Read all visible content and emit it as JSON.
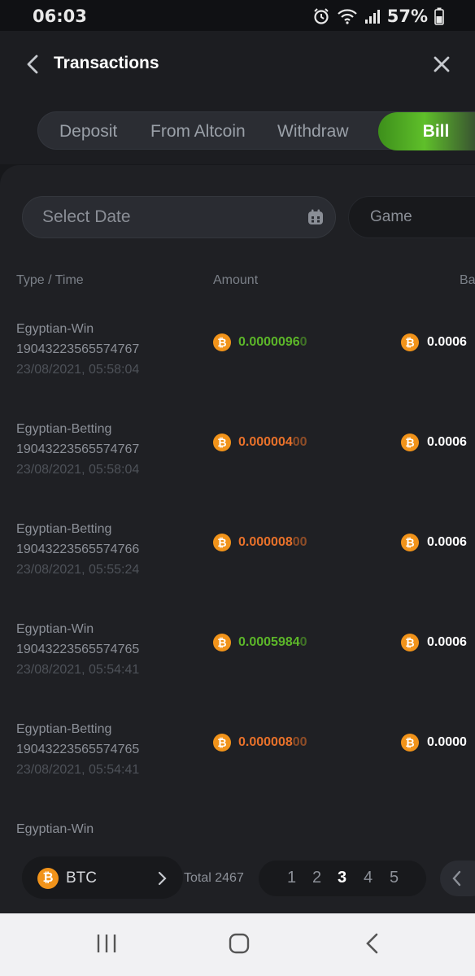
{
  "status_bar": {
    "time": "06:03",
    "battery": "57%",
    "icons": [
      "alarm-icon",
      "wifi-icon",
      "signal-icon",
      "battery-icon"
    ]
  },
  "header": {
    "title": "Transactions",
    "back_icon": "chevron-left-icon",
    "close_icon": "close-icon"
  },
  "tabs": [
    {
      "label": "Deposit",
      "active": false
    },
    {
      "label": "From Altcoin",
      "active": false
    },
    {
      "label": "Withdraw",
      "active": false
    },
    {
      "label": "Bill",
      "active": true
    }
  ],
  "filters": {
    "date_placeholder": "Select Date",
    "game_placeholder": "Game"
  },
  "columns": {
    "type_time": "Type / Time",
    "amount": "Amount",
    "balance": "Ba"
  },
  "rows": [
    {
      "type": "Egyptian-Win",
      "id": "19043223565574767",
      "time": "23/08/2021, 05:58:04",
      "amount": "0.0000096",
      "amount_tail": "0",
      "kind": "win",
      "balance": "0.0006"
    },
    {
      "type": "Egyptian-Betting",
      "id": "19043223565574767",
      "time": "23/08/2021, 05:58:04",
      "amount": "0.000004",
      "amount_tail": "00",
      "kind": "bet",
      "balance": "0.0006"
    },
    {
      "type": "Egyptian-Betting",
      "id": "19043223565574766",
      "time": "23/08/2021, 05:55:24",
      "amount": "0.000008",
      "amount_tail": "00",
      "kind": "bet",
      "balance": "0.0006"
    },
    {
      "type": "Egyptian-Win",
      "id": "19043223565574765",
      "time": "23/08/2021, 05:54:41",
      "amount": "0.0005984",
      "amount_tail": "0",
      "kind": "win",
      "balance": "0.0006"
    },
    {
      "type": "Egyptian-Betting",
      "id": "19043223565574765",
      "time": "23/08/2021, 05:54:41",
      "amount": "0.000008",
      "amount_tail": "00",
      "kind": "bet",
      "balance": "0.0000"
    },
    {
      "type": "Egyptian-Win",
      "id": "",
      "time": "",
      "amount": "",
      "amount_tail": "",
      "kind": "win",
      "balance": ""
    }
  ],
  "footer": {
    "currency": "BTC",
    "total": "Total 2467",
    "pages": [
      "1",
      "2",
      "3",
      "4",
      "5"
    ],
    "current_page": "3"
  },
  "colors": {
    "win": "#5cb629",
    "bet": "#e8712a",
    "accent": "#5fbf2a",
    "bitcoin": "#f1931a"
  },
  "nav_bar": {
    "icons": [
      "recents-icon",
      "home-icon",
      "back-icon"
    ]
  }
}
